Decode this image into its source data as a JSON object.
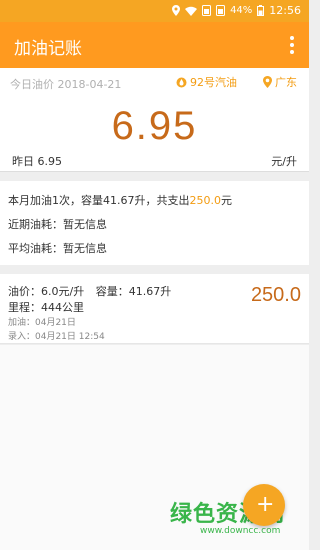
{
  "statusbar": {
    "battery": "44%",
    "time": "12:56"
  },
  "appbar": {
    "title": "加油记账"
  },
  "today": {
    "date_label": "今日油价 2018-04-21",
    "fuel_type": "92号汽油",
    "region": "广东",
    "price": "6.95",
    "yesterday": "昨日 6.95",
    "unit": "元/升"
  },
  "summary": {
    "month_prefix": "本月加油1次，容量41.67升，共支出",
    "month_amount": "250.0",
    "month_suffix": "元",
    "recent": "近期油耗：暂无信息",
    "average": "平均油耗：暂无信息"
  },
  "records": [
    {
      "price": "油价：6.0元/升",
      "volume": "容量：41.67升",
      "mileage": "里程：444公里",
      "refuel": "加油：04月21日",
      "entered": "录入：04月21日 12:54",
      "amount": "250.0"
    }
  ],
  "watermark": {
    "text": "绿色资源网",
    "url": "www.downcc.com"
  },
  "colors": {
    "accent": "#ff9a1f",
    "price": "#c76a1a",
    "highlight": "#f39c12"
  },
  "icons": [
    "location-icon",
    "wifi-icon",
    "sim-icon",
    "battery-icon",
    "drop-icon",
    "pin-icon",
    "more-icon",
    "add-icon"
  ]
}
